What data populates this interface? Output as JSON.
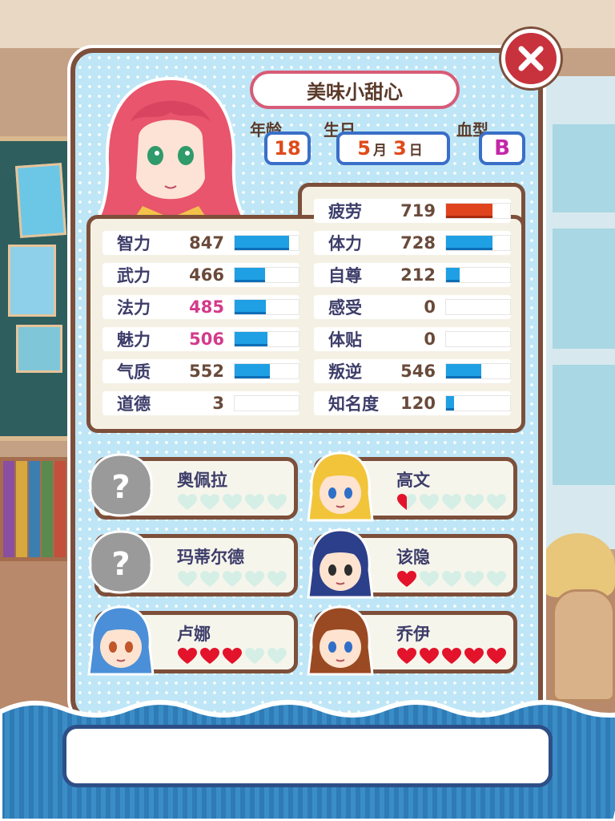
{
  "character": {
    "name": "美味小甜心",
    "age_label": "年龄",
    "age": "18",
    "birthday_label": "生日",
    "birth_month": "5",
    "month_unit": "月",
    "birth_day": "3",
    "day_unit": "日",
    "blood_label": "血型",
    "blood_type": "B"
  },
  "stats_left": [
    {
      "label": "智力",
      "value": "847",
      "level": 0.85,
      "highlight": false
    },
    {
      "label": "武力",
      "value": "466",
      "level": 0.47,
      "highlight": false
    },
    {
      "label": "法力",
      "value": "485",
      "level": 0.49,
      "highlight": true
    },
    {
      "label": "魅力",
      "value": "506",
      "level": 0.51,
      "highlight": true
    },
    {
      "label": "气质",
      "value": "552",
      "level": 0.55,
      "highlight": false
    },
    {
      "label": "道德",
      "value": "3",
      "level": 0.0,
      "highlight": false
    }
  ],
  "stats_right": [
    {
      "label": "疲劳",
      "value": "719",
      "level": 0.72,
      "color": "red"
    },
    {
      "label": "体力",
      "value": "728",
      "level": 0.73,
      "color": "blue"
    },
    {
      "label": "自尊",
      "value": "212",
      "level": 0.21,
      "color": "blue"
    },
    {
      "label": "感受",
      "value": "0",
      "level": 0.0,
      "color": "blue"
    },
    {
      "label": "体贴",
      "value": "0",
      "level": 0.0,
      "color": "blue"
    },
    {
      "label": "叛逆",
      "value": "546",
      "level": 0.55,
      "color": "blue"
    },
    {
      "label": "知名度",
      "value": "120",
      "level": 0.12,
      "color": "blue"
    }
  ],
  "relations": [
    {
      "name": "奥佩拉",
      "avatar": "unknown-silhouette",
      "hearts": 0
    },
    {
      "name": "高文",
      "avatar": "blonde-boy",
      "hearts": 0.5
    },
    {
      "name": "玛蒂尔德",
      "avatar": "unknown-silhouette",
      "hearts": 0
    },
    {
      "name": "该隐",
      "avatar": "blue-hair-boy",
      "hearts": 1
    },
    {
      "name": "卢娜",
      "avatar": "blue-hair-girl",
      "hearts": 3
    },
    {
      "name": "乔伊",
      "avatar": "brown-hair-boy",
      "hearts": 5
    }
  ],
  "hearts_max": 5,
  "colors": {
    "panel_border": "#7d4f3b",
    "panel_bg": "#bfe6f6",
    "bar_blue": "#1f9fe4",
    "bar_red": "#e0441f",
    "heart_full": "#e3132b",
    "heart_empty": "#d6efe6",
    "close_button": "#c8323d"
  }
}
